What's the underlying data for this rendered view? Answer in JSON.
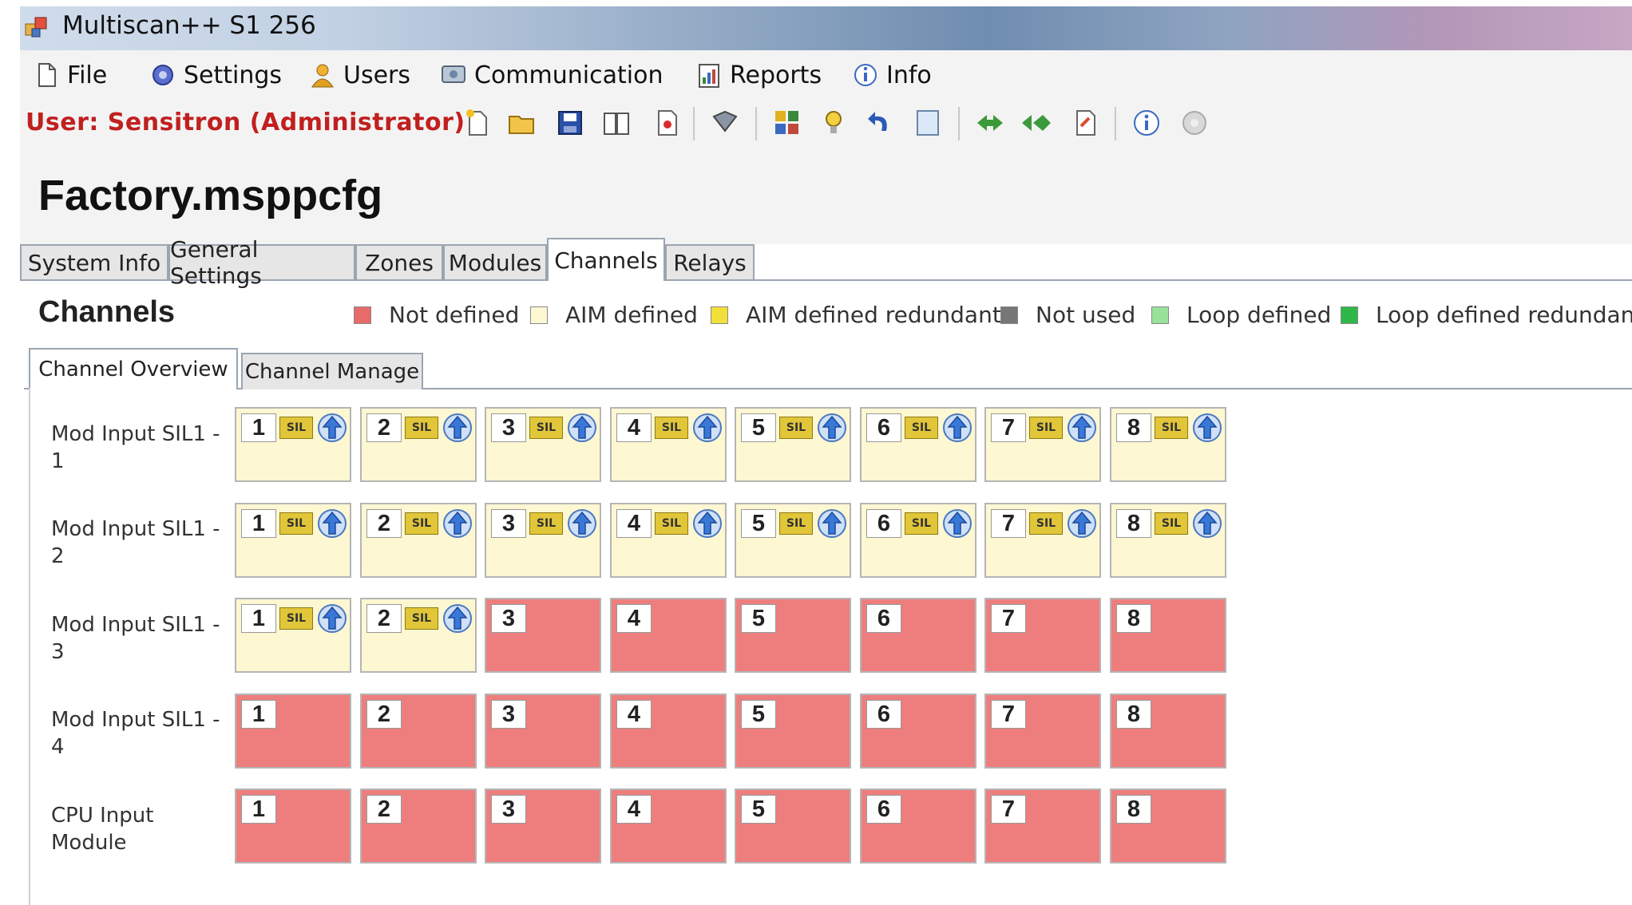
{
  "window": {
    "title": "Multiscan++ S1 256"
  },
  "menu": {
    "items": [
      {
        "label": "File",
        "icon": "file-icon"
      },
      {
        "label": "Settings",
        "icon": "settings-icon"
      },
      {
        "label": "Users",
        "icon": "users-icon"
      },
      {
        "label": "Communication",
        "icon": "communication-icon"
      },
      {
        "label": "Reports",
        "icon": "reports-icon"
      },
      {
        "label": "Info",
        "icon": "info-icon"
      }
    ]
  },
  "toolbar": {
    "user_label": "User: Sensitron  (Administrator)",
    "buttons": [
      "new-icon",
      "open-icon",
      "save-icon",
      "book-icon",
      "pdf-icon",
      "tools-icon",
      "modules-icon",
      "bulb-icon",
      "undo-icon",
      "list-icon",
      "download-icon",
      "upload-icon",
      "export-icon",
      "info-icon",
      "help-icon"
    ]
  },
  "document": {
    "title": "Factory.msppcfg"
  },
  "main_tabs": {
    "items": [
      "System Info",
      "General Settings",
      "Zones",
      "Modules",
      "Channels",
      "Relays"
    ],
    "active": "Channels"
  },
  "channels": {
    "heading": "Channels",
    "legend": [
      {
        "label": "Not defined",
        "color": "#e86a6a"
      },
      {
        "label": "AIM defined",
        "color": "#fdf7d2"
      },
      {
        "label": "AIM defined redundant",
        "color": "#f2e03a"
      },
      {
        "label": "Not used",
        "color": "#777777"
      },
      {
        "label": "Loop defined",
        "color": "#98e29a"
      },
      {
        "label": "Loop defined redundant",
        "color": "#2fb84a"
      }
    ],
    "sub_tabs": {
      "items": [
        "Channel Overview",
        "Channel Manage"
      ],
      "active": "Channel Overview"
    },
    "sil_badge": "SIL",
    "rows": [
      {
        "label": "Mod Input SIL1 - 1",
        "states": [
          "aim",
          "aim",
          "aim",
          "aim",
          "aim",
          "aim",
          "aim",
          "aim"
        ]
      },
      {
        "label": "Mod Input SIL1 - 2",
        "states": [
          "aim",
          "aim",
          "aim",
          "aim",
          "aim",
          "aim",
          "aim",
          "aim"
        ]
      },
      {
        "label": "Mod Input SIL1 - 3",
        "states": [
          "aim",
          "aim",
          "undef",
          "undef",
          "undef",
          "undef",
          "undef",
          "undef"
        ]
      },
      {
        "label": "Mod Input SIL1 - 4",
        "states": [
          "undef",
          "undef",
          "undef",
          "undef",
          "undef",
          "undef",
          "undef",
          "undef"
        ]
      },
      {
        "label": "CPU Input Module",
        "states": [
          "undef",
          "undef",
          "undef",
          "undef",
          "undef",
          "undef",
          "undef",
          "undef"
        ]
      }
    ],
    "channel_numbers": [
      "1",
      "2",
      "3",
      "4",
      "5",
      "6",
      "7",
      "8"
    ]
  }
}
